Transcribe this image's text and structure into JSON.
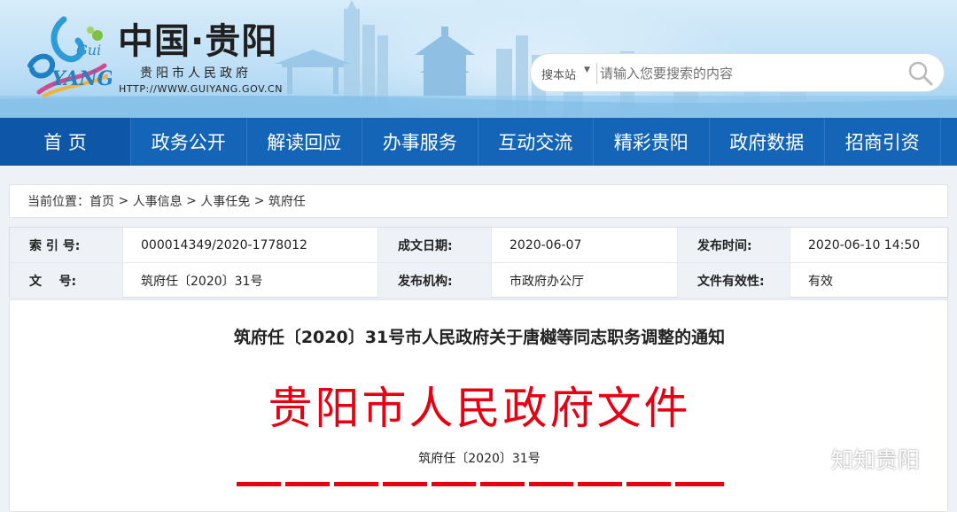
{
  "header": {
    "site_title": "中国·贵阳",
    "site_subtitle": "贵阳市人民政府",
    "site_url": "HTTP://WWW.GUIYANG.GOV.CN",
    "logo_text": "GuiYang"
  },
  "search": {
    "scope": "搜本站",
    "placeholder": "请输入您要搜索的内容"
  },
  "nav": {
    "items": [
      {
        "label": "首 页"
      },
      {
        "label": "政务公开"
      },
      {
        "label": "解读回应"
      },
      {
        "label": "办事服务"
      },
      {
        "label": "互动交流"
      },
      {
        "label": "精彩贵阳"
      },
      {
        "label": "政府数据"
      },
      {
        "label": "招商引资"
      }
    ]
  },
  "breadcrumb": {
    "prefix": "当前位置：",
    "items": [
      "首页",
      "人事信息",
      "人事任免",
      "筑府任"
    ],
    "separator": " > "
  },
  "meta": {
    "index_label": "索 引 号:",
    "index_value": "000014349/2020-1778012",
    "created_label": "成文日期:",
    "created_value": "2020-06-07",
    "published_label": "发布时间:",
    "published_value": "2020-06-10 14:50",
    "docno_label": "文    号:",
    "docno_value": "筑府任〔2020〕31号",
    "org_label": "发布机构:",
    "org_value": "市政府办公厅",
    "validity_label": "文件有效性:",
    "validity_value": "有效"
  },
  "document": {
    "title": "筑府任〔2020〕31号市人民政府关于唐樾等同志职务调整的通知",
    "header": "贵阳市人民政府文件",
    "number": "筑府任〔2020〕31号"
  },
  "watermark": {
    "text": "知知贵阳"
  },
  "colors": {
    "nav_bg": "#1465b8",
    "nav_active": "#0e57a8",
    "doc_red": "#e60012"
  }
}
